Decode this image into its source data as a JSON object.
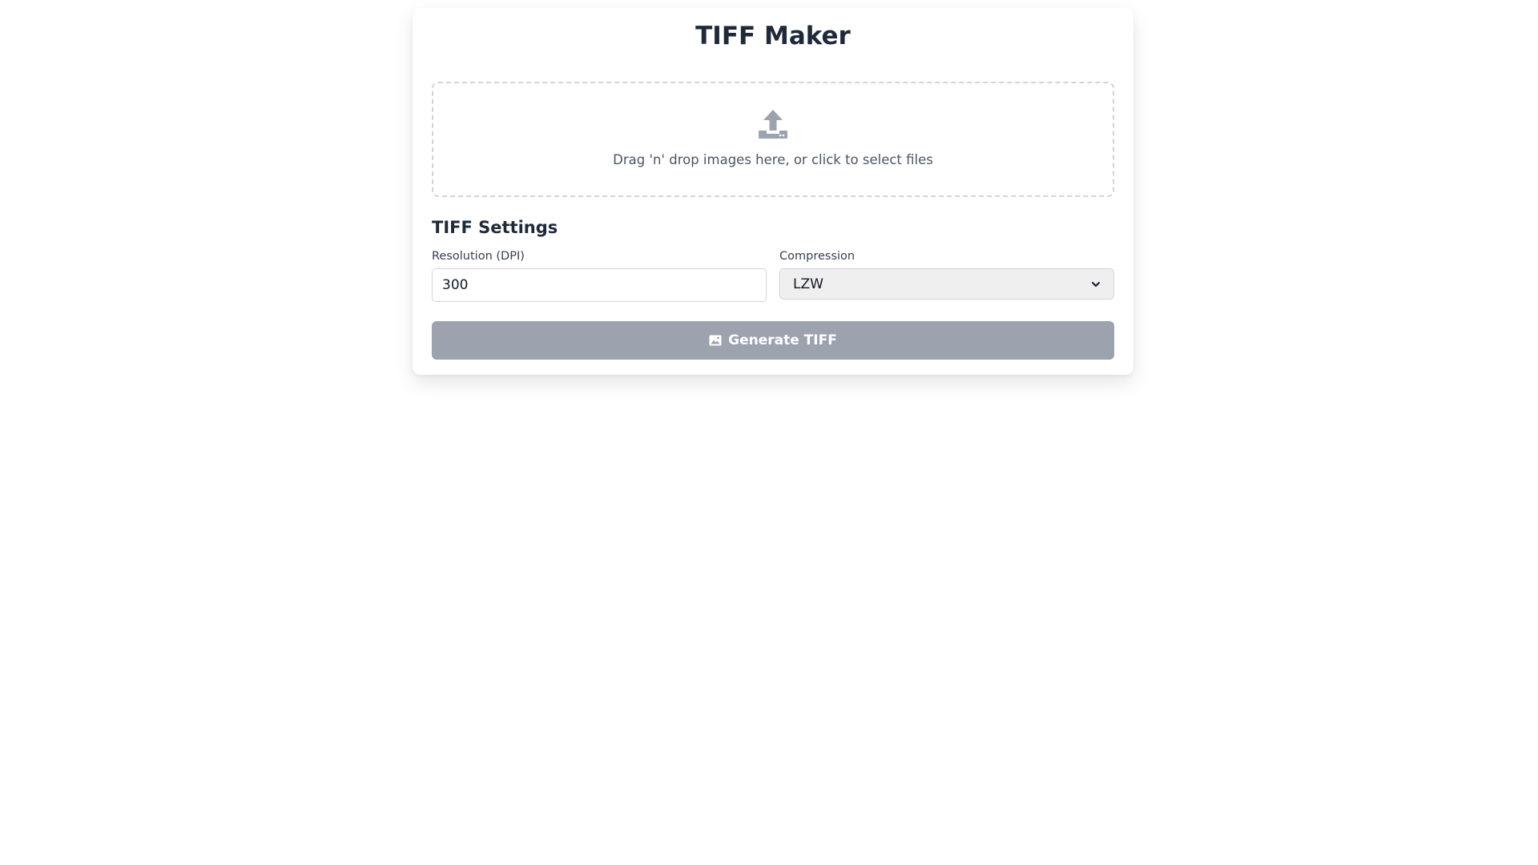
{
  "app": {
    "title": "TIFF Maker"
  },
  "dropzone": {
    "icon": "upload-icon",
    "text": "Drag 'n' drop images here, or click to select files"
  },
  "settings": {
    "heading": "TIFF Settings",
    "resolution": {
      "label": "Resolution (DPI)",
      "value": "300"
    },
    "compression": {
      "label": "Compression",
      "selected": "LZW"
    }
  },
  "generate_button": {
    "icon": "image-icon",
    "label": "Generate TIFF",
    "disabled": true
  },
  "colors": {
    "text_primary": "#1f2937",
    "text_muted": "#4b5563",
    "button_disabled_bg": "#9ca3af",
    "select_bg": "#efefef",
    "border": "#d1d5db"
  }
}
